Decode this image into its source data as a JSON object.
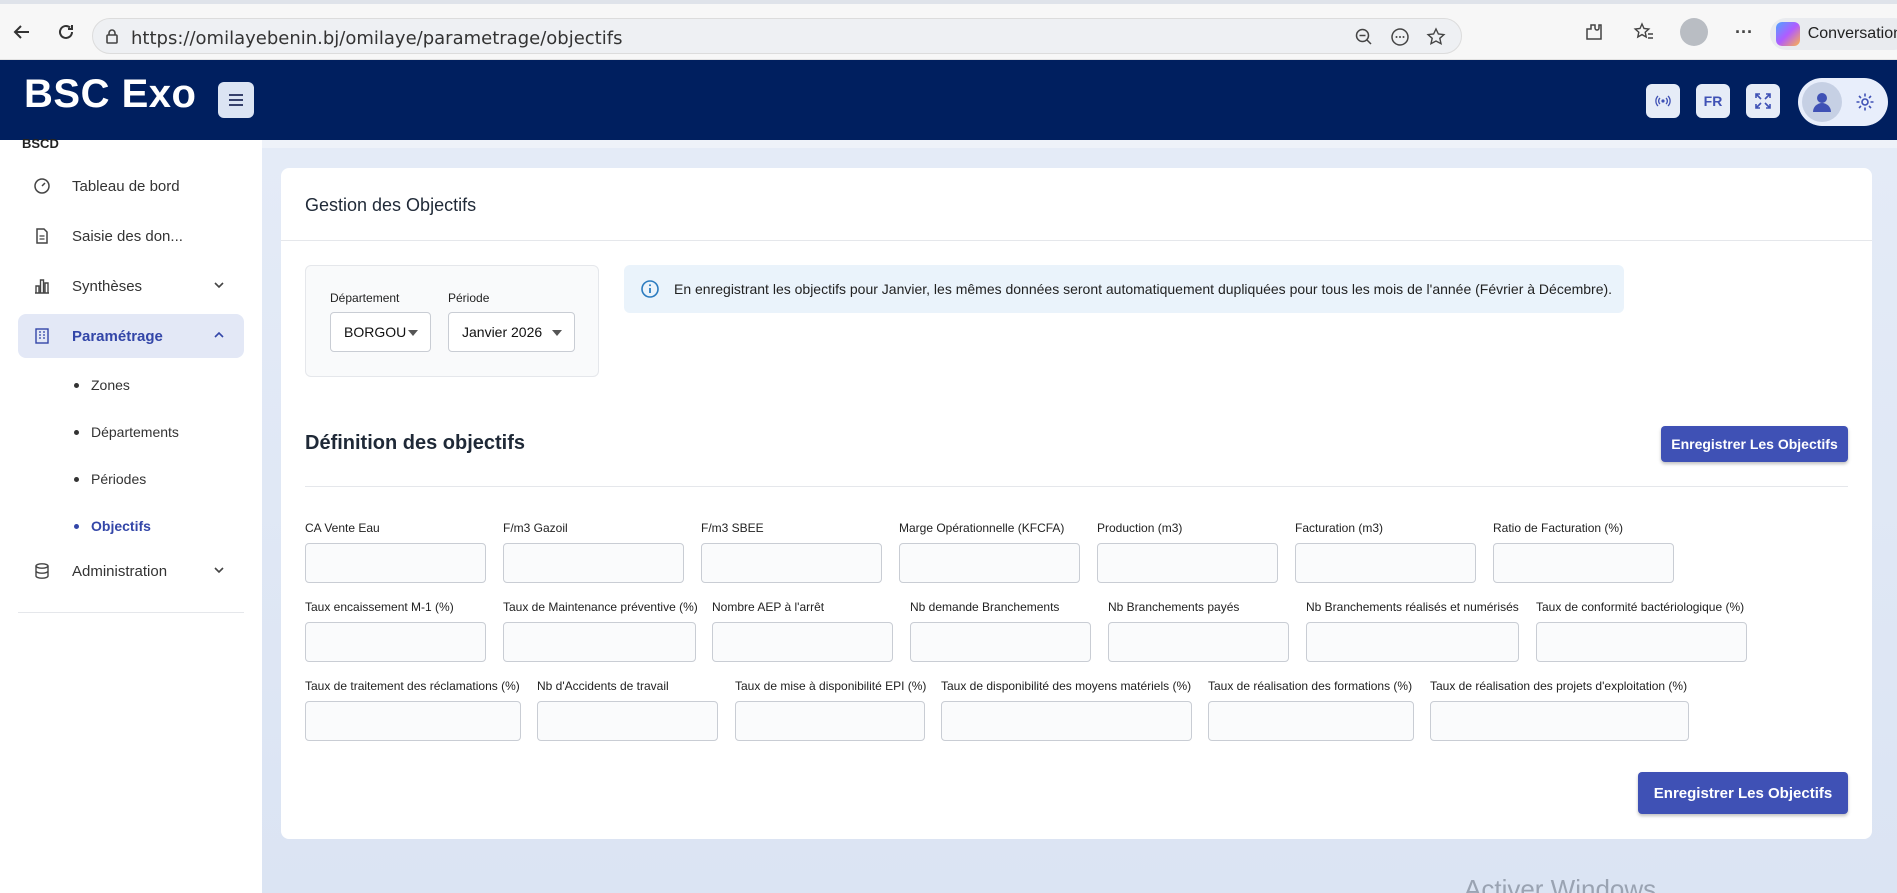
{
  "browser": {
    "url": "https://omilayebenin.bj/omilaye/parametrage/objectifs",
    "copilot_label": "Conversations"
  },
  "header": {
    "brand": "BSC Exo",
    "lang": "FR"
  },
  "sidebar": {
    "section": "BSCD",
    "items": [
      {
        "label": "Tableau de bord"
      },
      {
        "label": "Saisie des don..."
      },
      {
        "label": "Synthèses"
      },
      {
        "label": "Paramétrage"
      },
      {
        "label": "Administration"
      }
    ],
    "subitems": [
      {
        "label": "Zones"
      },
      {
        "label": "Départements"
      },
      {
        "label": "Périodes"
      },
      {
        "label": "Objectifs"
      }
    ]
  },
  "card": {
    "title": "Gestion des Objectifs",
    "filters": {
      "department_label": "Département",
      "department_value": "BORGOU",
      "period_label": "Période",
      "period_value": "Janvier 2026"
    },
    "info": "En enregistrant les objectifs pour Janvier, les mêmes données seront automatiquement dupliquées pour tous les mois de l'année (Février à Décembre).",
    "definition_title": "Définition des objectifs",
    "save_label": "Enregistrer Les Objectifs",
    "fields_row1": [
      "CA Vente Eau",
      "F/m3 Gazoil",
      "F/m3 SBEE",
      "Marge Opérationnelle (KFCFA)",
      "Production (m3)",
      "Facturation (m3)",
      "Ratio de Facturation (%)"
    ],
    "fields_row2": [
      "Taux encaissement M-1 (%)",
      "Taux de Maintenance préventive (%)",
      "Nombre AEP à l'arrêt",
      "Nb demande Branchements",
      "Nb Branchements payés",
      "Nb Branchements réalisés et numérisés",
      "Taux de conformité bactériologique (%)"
    ],
    "fields_row3": [
      "Taux de traitement des réclamations (%)",
      "Nb d'Accidents de travail",
      "Taux de mise à disponibilité EPI (%)",
      "Taux de disponibilité des moyens matériels (%)",
      "Taux de réalisation des formations (%)",
      "Taux de réalisation des projets d'exploitation (%)"
    ]
  },
  "watermark": "Activer Windows",
  "colors": {
    "header_bg": "#001f5f",
    "accent": "#3f51b5",
    "active_bg": "#e3e8f6"
  }
}
